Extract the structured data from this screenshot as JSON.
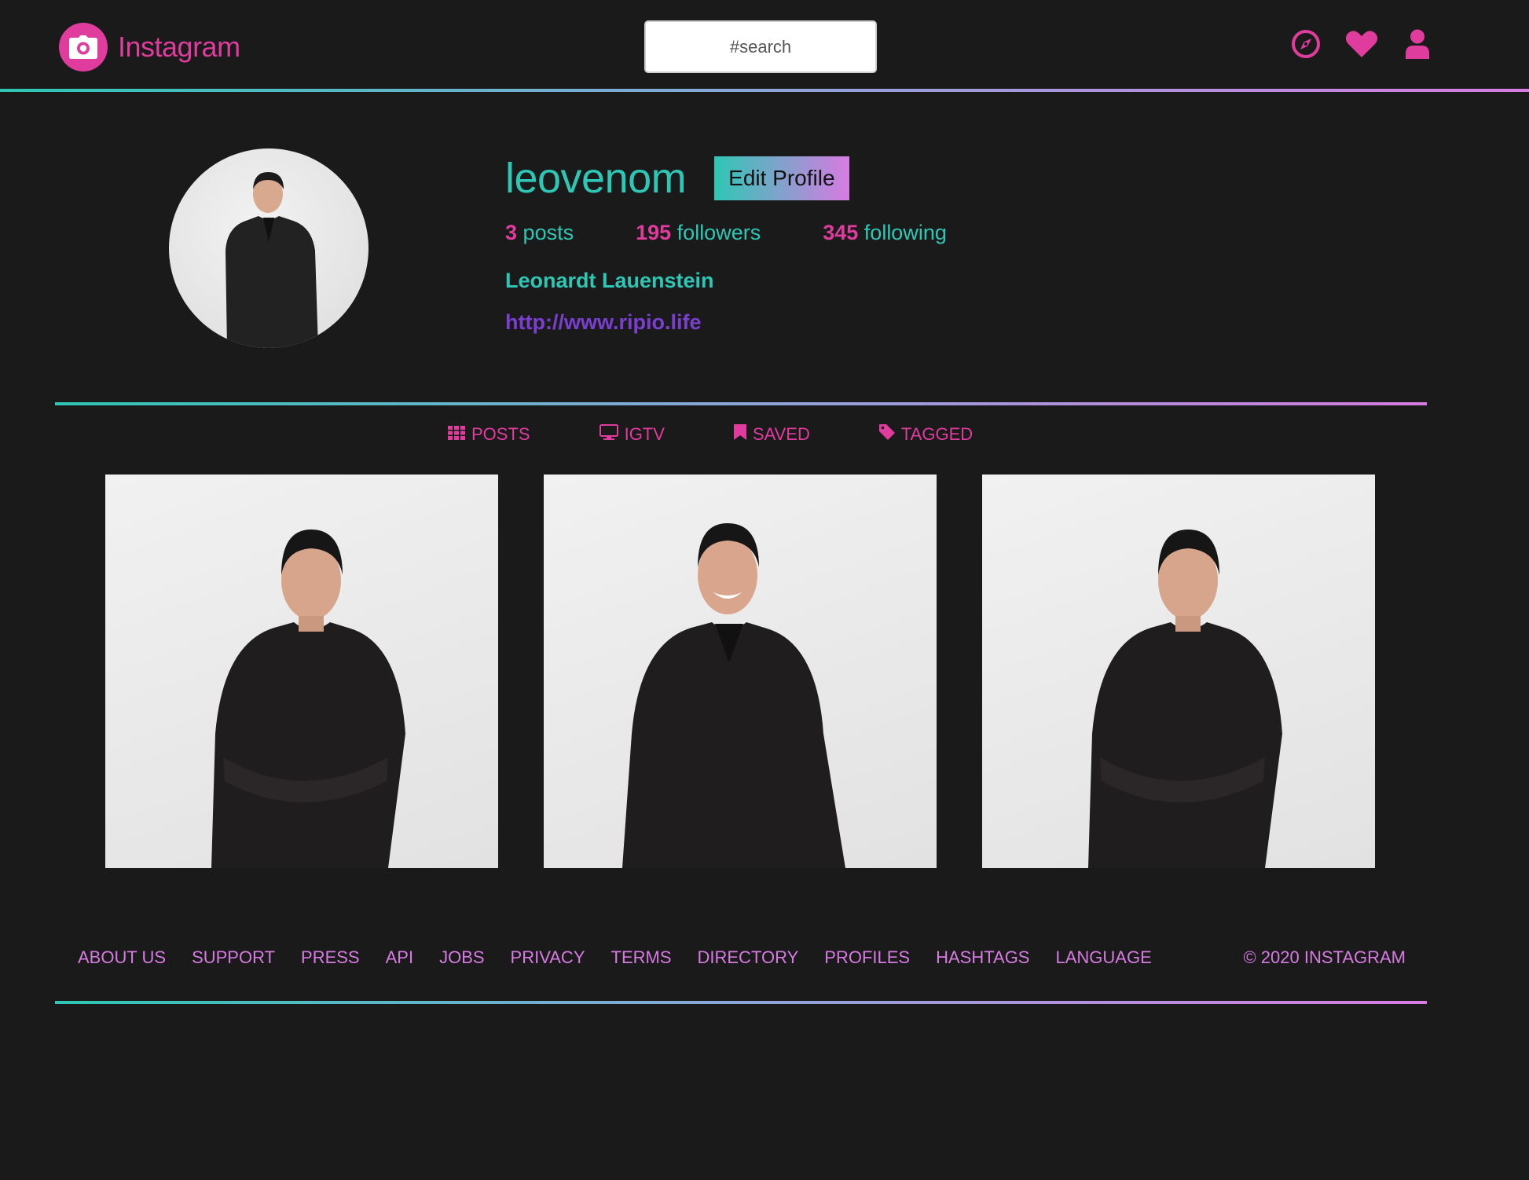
{
  "header": {
    "brand": "Instagram",
    "search_placeholder": "#search",
    "icons": [
      "compass-icon",
      "heart-icon",
      "user-icon"
    ]
  },
  "colors": {
    "background": "#1a1a1a",
    "pink": "#e03c9e",
    "teal": "#2ec7b5",
    "lavender": "#d77be2",
    "purple": "#7b3fd0"
  },
  "profile": {
    "username": "leovenom",
    "edit_label": "Edit Profile",
    "stats": [
      {
        "value": "3",
        "label": "posts"
      },
      {
        "value": "195",
        "label": "followers"
      },
      {
        "value": "345",
        "label": "following"
      }
    ],
    "full_name": "Leonardt Lauenstein",
    "website": "http://www.ripio.life"
  },
  "tabs": [
    {
      "label": "POSTS",
      "icon": "grid-icon"
    },
    {
      "label": "IGTV",
      "icon": "tv-icon"
    },
    {
      "label": "SAVED",
      "icon": "bookmark-icon"
    },
    {
      "label": "TAGGED",
      "icon": "tag-icon"
    }
  ],
  "footer": {
    "links": [
      "ABOUT US",
      "SUPPORT",
      "PRESS",
      "API",
      "JOBS",
      "PRIVACY",
      "TERMS",
      "DIRECTORY",
      "PROFILES",
      "HASHTAGS",
      "LANGUAGE"
    ],
    "copyright": "© 2020 INSTAGRAM"
  }
}
